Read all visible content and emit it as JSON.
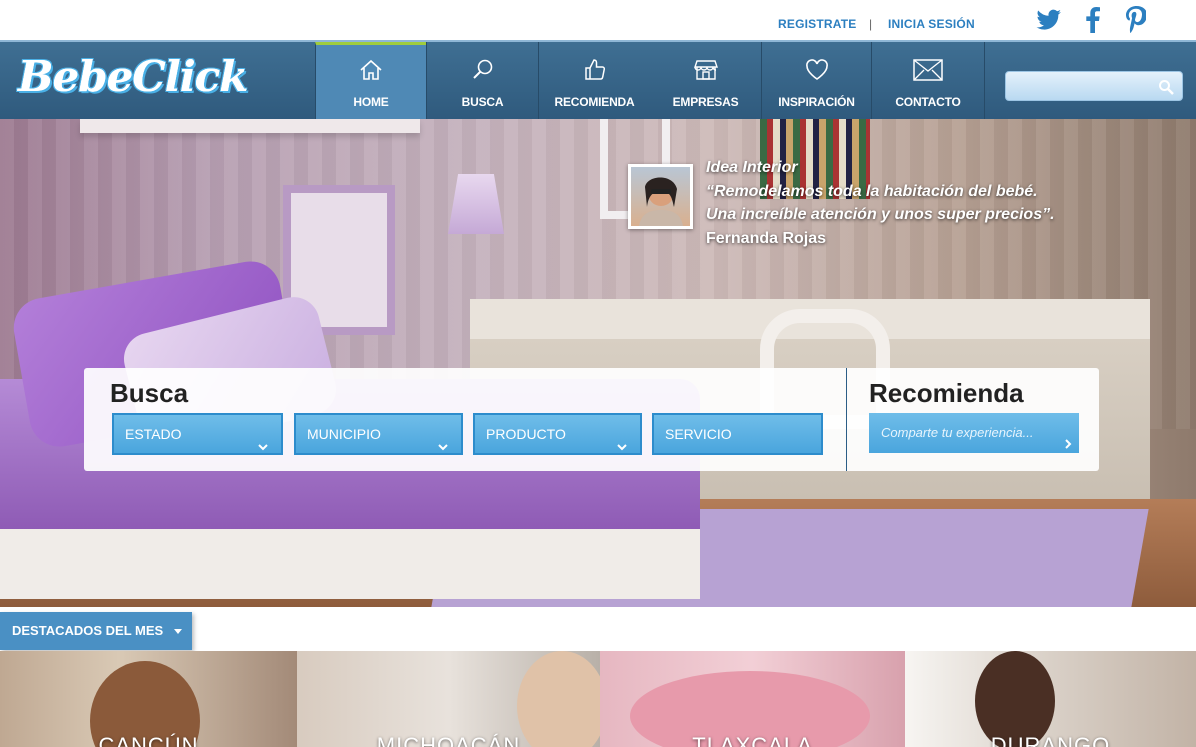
{
  "topbar": {
    "register": "REGISTRATE",
    "separator": "|",
    "login": "INICIA SESIÓN",
    "social": [
      "twitter-icon",
      "facebook-icon",
      "pinterest-icon"
    ]
  },
  "brand": {
    "logo_text": "BebeClick"
  },
  "nav": {
    "items": [
      {
        "label": "HOME",
        "icon": "home-icon",
        "active": true
      },
      {
        "label": "BUSCA",
        "icon": "search-icon"
      },
      {
        "label": "RECOMIENDA",
        "icon": "thumbs-up-icon"
      },
      {
        "label": "EMPRESAS",
        "icon": "store-icon"
      },
      {
        "label": "INSPIRACIÓN",
        "icon": "heart-icon"
      },
      {
        "label": "CONTACTO",
        "icon": "envelope-icon"
      }
    ],
    "search_placeholder": ""
  },
  "hero": {
    "testimonial": {
      "line1": "Idea Interior",
      "line2": "“Remodelamos toda la habitación del bebé.",
      "line3": "Una increíble atención y unos super precios”.",
      "author": "Fernanda Rojas"
    }
  },
  "search_panel": {
    "busca_title": "Busca",
    "filters": [
      "ESTADO",
      "MUNICIPIO",
      "PRODUCTO",
      "SERVICIO"
    ],
    "recomienda_title": "Recomienda",
    "recomienda_placeholder": "Comparte tu experiencia..."
  },
  "featured": {
    "tab_label": "DESTACADOS DEL MES",
    "cards": [
      "CANCÚN",
      "MICHOACÁN",
      "TLAXCALA",
      "DURANGO"
    ]
  },
  "colors": {
    "nav_bg": "#356182",
    "accent_blue": "#4aa5dd",
    "link_blue": "#2c7fc0",
    "active_bar": "#9fcd3d"
  }
}
